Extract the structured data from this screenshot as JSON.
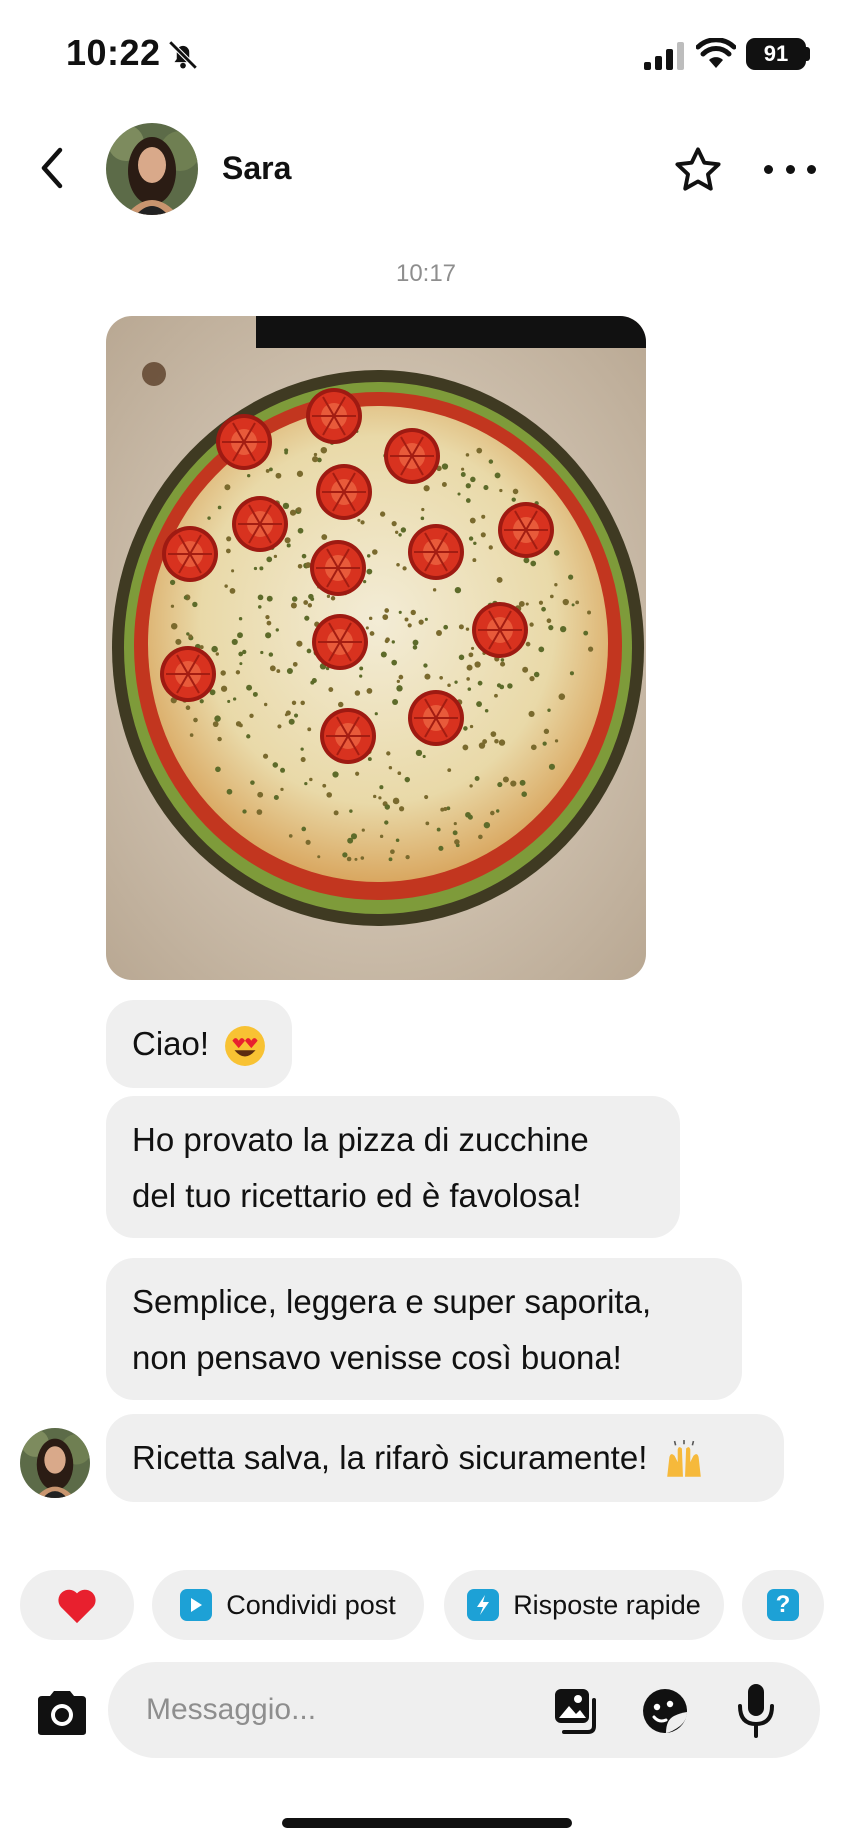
{
  "status_bar": {
    "time": "10:22",
    "battery": "91"
  },
  "header": {
    "name": "Sara"
  },
  "conversation": {
    "timestamp": "10:17",
    "messages": [
      {
        "text": "Ciao! ",
        "emoji": "heart-eyes"
      },
      {
        "line1": "Ho provato la pizza di zucchine",
        "line2": "del tuo ricettario ed è favolosa!"
      },
      {
        "line1": "Semplice, leggera e super saporita,",
        "line2": "non pensavo venisse così buona!"
      },
      {
        "text": "Ricetta salva, la rifarò sicuramente! ",
        "emoji": "raising-hands"
      }
    ]
  },
  "quick_actions": {
    "share_label": "Condividi post",
    "quick_replies_label": "Risposte rapide",
    "help_symbol": "?"
  },
  "composer": {
    "placeholder": "Messaggio..."
  },
  "icons": {
    "back": "chevron-left-icon",
    "star": "star-outline-icon",
    "more": "more-horizontal-icon",
    "camera": "camera-icon",
    "gallery": "gallery-icon",
    "sticker": "sticker-icon",
    "mic": "microphone-icon"
  },
  "colors": {
    "accent": "#1da1d6",
    "bubble": "#efefef",
    "heart": "#e8202e"
  }
}
